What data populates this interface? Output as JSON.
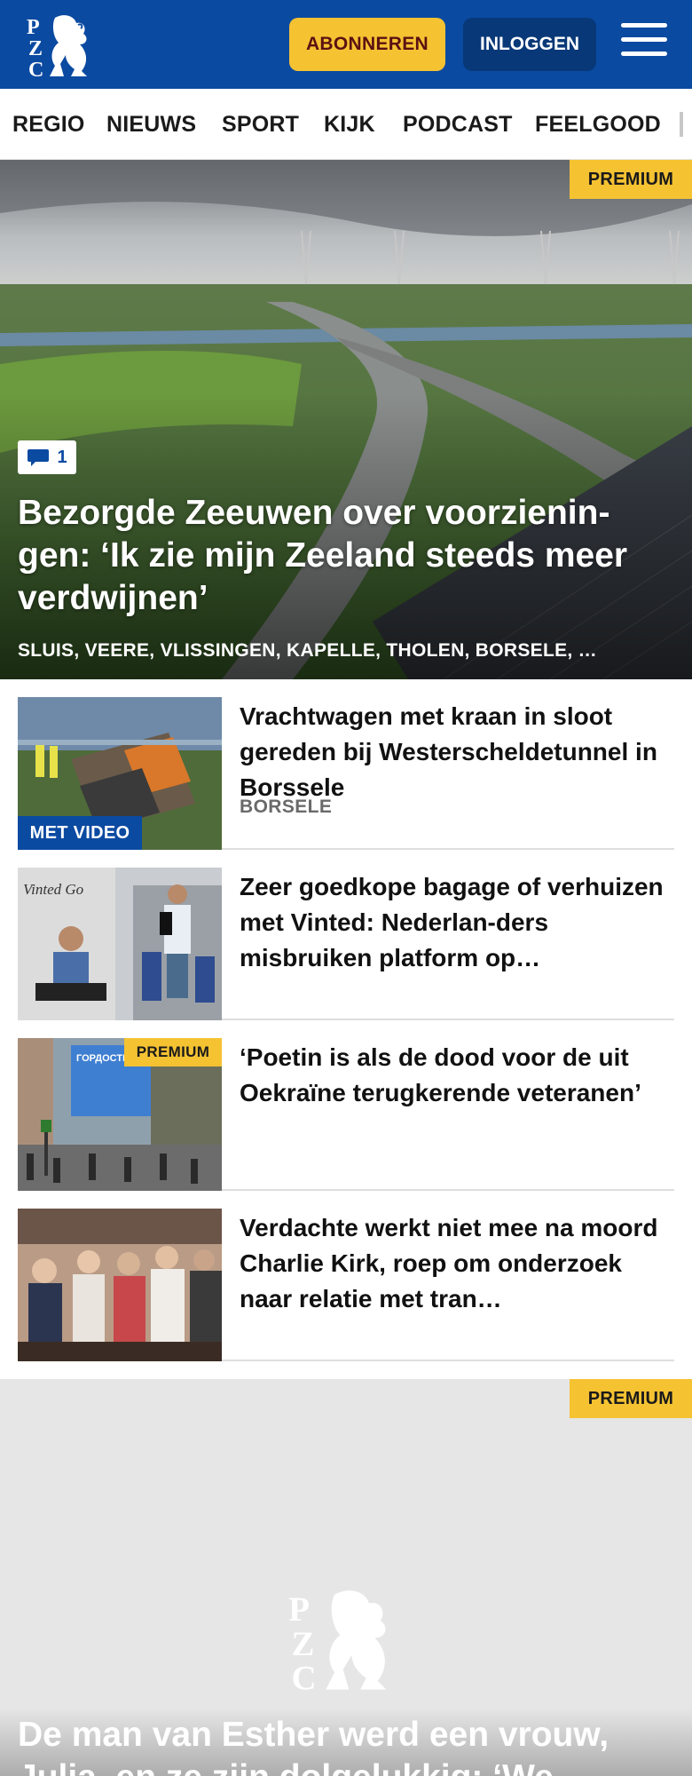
{
  "header": {
    "logo_letters": "PZC",
    "subscribe_label": "ABONNEREN",
    "login_label": "INLOGGEN"
  },
  "nav": {
    "items": [
      {
        "label": "REGIO"
      },
      {
        "label": "NIEUWS"
      },
      {
        "label": "SPORT"
      },
      {
        "label": "KIJK"
      },
      {
        "label": "PODCAST"
      },
      {
        "label": "FEELGOOD"
      }
    ]
  },
  "hero": {
    "premium_label": "PREMIUM",
    "comment_count": "1",
    "title": "Bezorgde Zeeuwen over voorzienin-gen: ‘Ik zie mijn Zeeland steeds meer verdwijnen’",
    "places": "SLUIS, VEERE, VLISSINGEN, KAPELLE, THOLEN, BORSELE, …"
  },
  "articles": [
    {
      "title": "Vrachtwagen met kraan in sloot gereden bij Westerscheldetunnel in Borssele",
      "place": "BORSELE",
      "badge": "MET VIDEO"
    },
    {
      "title": "Zeer goedkope bagage of verhuizen met Vinted: Nederlan-ders misbruiken platform op…",
      "thumb_text": "Vinted Go"
    },
    {
      "title": "‘Poetin is als de dood voor de uit Oekraïne terugkerende veteranen’",
      "badge": "PREMIUM",
      "thumb_text": "ГОРДОСТЬ РОССИИ!"
    },
    {
      "title": "Verdachte werkt niet mee na moord Charlie Kirk, roep om onderzoek naar relatie met tran…"
    }
  ],
  "teaser": {
    "premium_label": "PREMIUM",
    "title": "De man van Esther werd een vrouw, Julia, en ze zijn dolgelukkig: ‘We"
  },
  "colors": {
    "brand_blue": "#0b4aa1",
    "login_blue": "#083877",
    "accent_yellow": "#f5c232",
    "subscribe_text": "#5a1212",
    "divider": "#dedede",
    "teaser_bg": "#e6e6e6"
  },
  "icons": {
    "logo": "pzc-lion-logo",
    "menu": "hamburger-menu-icon",
    "comment": "comment-bubble-icon"
  }
}
